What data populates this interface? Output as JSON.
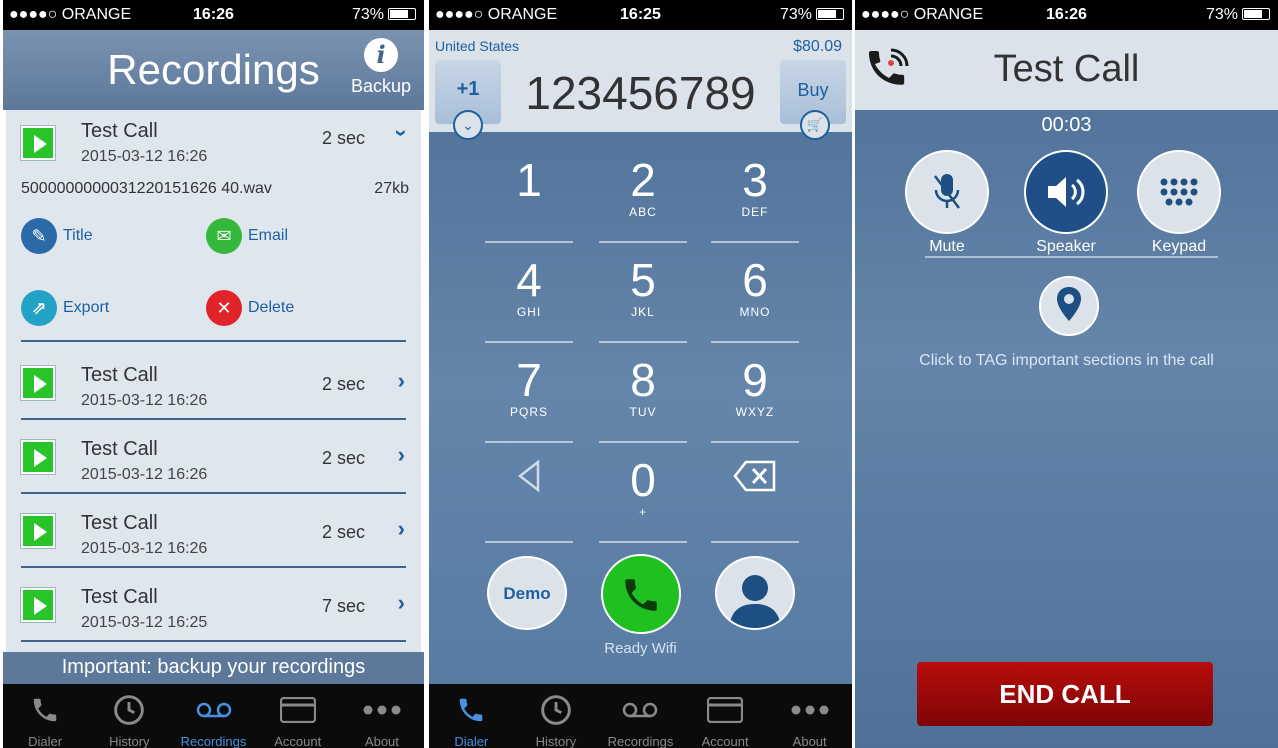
{
  "recordings_screen": {
    "status": {
      "carrier": "●●●●○ ORANGE",
      "time": "16:26",
      "battery": "73%"
    },
    "title": "Recordings",
    "backup_label": "Backup",
    "expanded": {
      "name": "Test Call",
      "date": "2015-03-12 16:26",
      "duration": "2 sec",
      "filename": "5000000000031220151626 40.wav",
      "filesize": "27kb",
      "actions": {
        "title": "Title",
        "email": "Email",
        "export": "Export",
        "delete": "Delete"
      }
    },
    "items": [
      {
        "name": "Test Call",
        "date": "2015-03-12 16:26",
        "duration": "2 sec"
      },
      {
        "name": "Test Call",
        "date": "2015-03-12 16:26",
        "duration": "2 sec"
      },
      {
        "name": "Test Call",
        "date": "2015-03-12 16:26",
        "duration": "2 sec"
      },
      {
        "name": "Test Call",
        "date": "2015-03-12 16:25",
        "duration": "7 sec"
      }
    ],
    "banner": "Important: backup your recordings",
    "tabs": [
      "Dialer",
      "History",
      "Recordings",
      "Account",
      "About"
    ]
  },
  "dialer_screen": {
    "status": {
      "carrier": "●●●●○ ORANGE",
      "time": "16:25",
      "battery": "73%"
    },
    "country": "United States",
    "credit": "$80.09",
    "country_code": "+1",
    "number": "123456789",
    "buy_label": "Buy",
    "keys": [
      {
        "digit": "1",
        "letters": ""
      },
      {
        "digit": "2",
        "letters": "ABC"
      },
      {
        "digit": "3",
        "letters": "DEF"
      },
      {
        "digit": "4",
        "letters": "GHI"
      },
      {
        "digit": "5",
        "letters": "JKL"
      },
      {
        "digit": "6",
        "letters": "MNO"
      },
      {
        "digit": "7",
        "letters": "PQRS"
      },
      {
        "digit": "8",
        "letters": "TUV"
      },
      {
        "digit": "9",
        "letters": "WXYZ"
      },
      {
        "digit": "0",
        "letters": "+"
      }
    ],
    "demo_label": "Demo",
    "ready_label": "Ready Wifi",
    "tabs": [
      "Dialer",
      "History",
      "Recordings",
      "Account",
      "About"
    ]
  },
  "call_screen": {
    "status": {
      "carrier": "●●●●○ ORANGE",
      "time": "16:26",
      "battery": "73%"
    },
    "title": "Test Call",
    "timer": "00:03",
    "mute_label": "Mute",
    "speaker_label": "Speaker",
    "keypad_label": "Keypad",
    "tag_text": "Click to TAG important sections in the call",
    "end_call_label": "END CALL"
  },
  "colors": {
    "accent": "#1d5f9f",
    "play_green": "#28c42a",
    "call_green": "#21c021",
    "end_red": "#a00909",
    "delete_red": "#e0242a"
  }
}
